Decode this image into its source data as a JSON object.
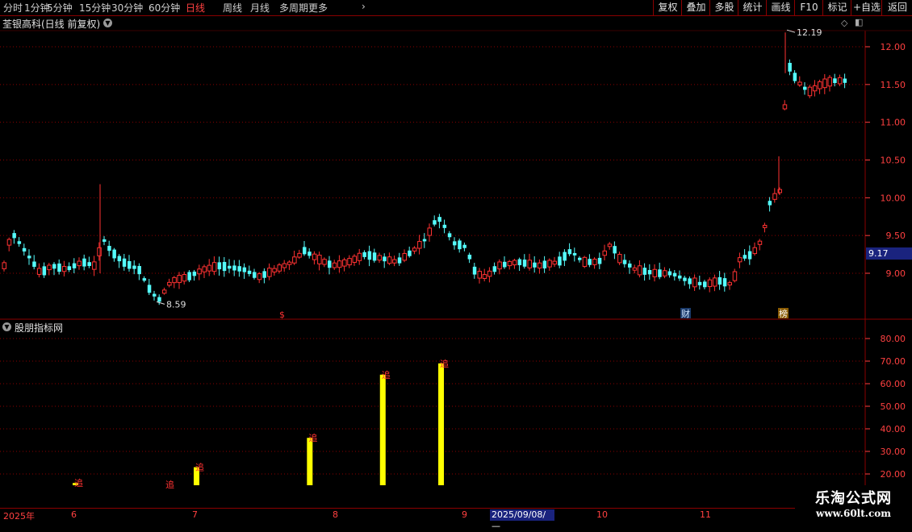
{
  "toolbar": {
    "timeframes": [
      "分时",
      "1分钟",
      "5分钟",
      "15分钟",
      "30分钟",
      "60分钟",
      "日线",
      "周线",
      "月线",
      "多周期",
      "更多"
    ],
    "active_index": 6,
    "buttons": [
      "复权",
      "叠加",
      "多股",
      "统计",
      "画线",
      "F10",
      "标记",
      "+自选",
      "返回"
    ]
  },
  "chart": {
    "title": "荃银高科(日线 前复权)",
    "price_axis": [
      "12.00",
      "11.50",
      "11.00",
      "10.50",
      "10.00",
      "9.50",
      "9.00"
    ],
    "high_label": "12.19",
    "low_label": "8.59",
    "current_price": "9.17",
    "markers": {
      "dollar": "$",
      "cai": "财",
      "bang": "榜"
    }
  },
  "indicator": {
    "title": "股朋指标网",
    "axis": [
      "80.00",
      "70.00",
      "60.00",
      "50.00",
      "40.00",
      "30.00",
      "20.00"
    ],
    "bar_label": "追",
    "bars": [
      {
        "date": "2025-06-01",
        "value": 16
      },
      {
        "date": "2025-07-01",
        "value": 23
      },
      {
        "date": "2025-07-26",
        "value": 36
      },
      {
        "date": "2025-08-12",
        "value": 64
      },
      {
        "date": "2025-08-26",
        "value": 69
      }
    ]
  },
  "colors": {
    "up": "#ff3232",
    "down": "#54fcfc",
    "bar": "#ffff00",
    "axis": "#ff4040",
    "grid": "#8b0000"
  },
  "time_axis": {
    "year": "2025年",
    "months": [
      "6",
      "7",
      "8",
      "9",
      "10",
      "11"
    ],
    "cursor": "2025/09/08/—"
  },
  "watermark": {
    "name": "乐淘公式网",
    "url": "www.60lt.com"
  }
}
